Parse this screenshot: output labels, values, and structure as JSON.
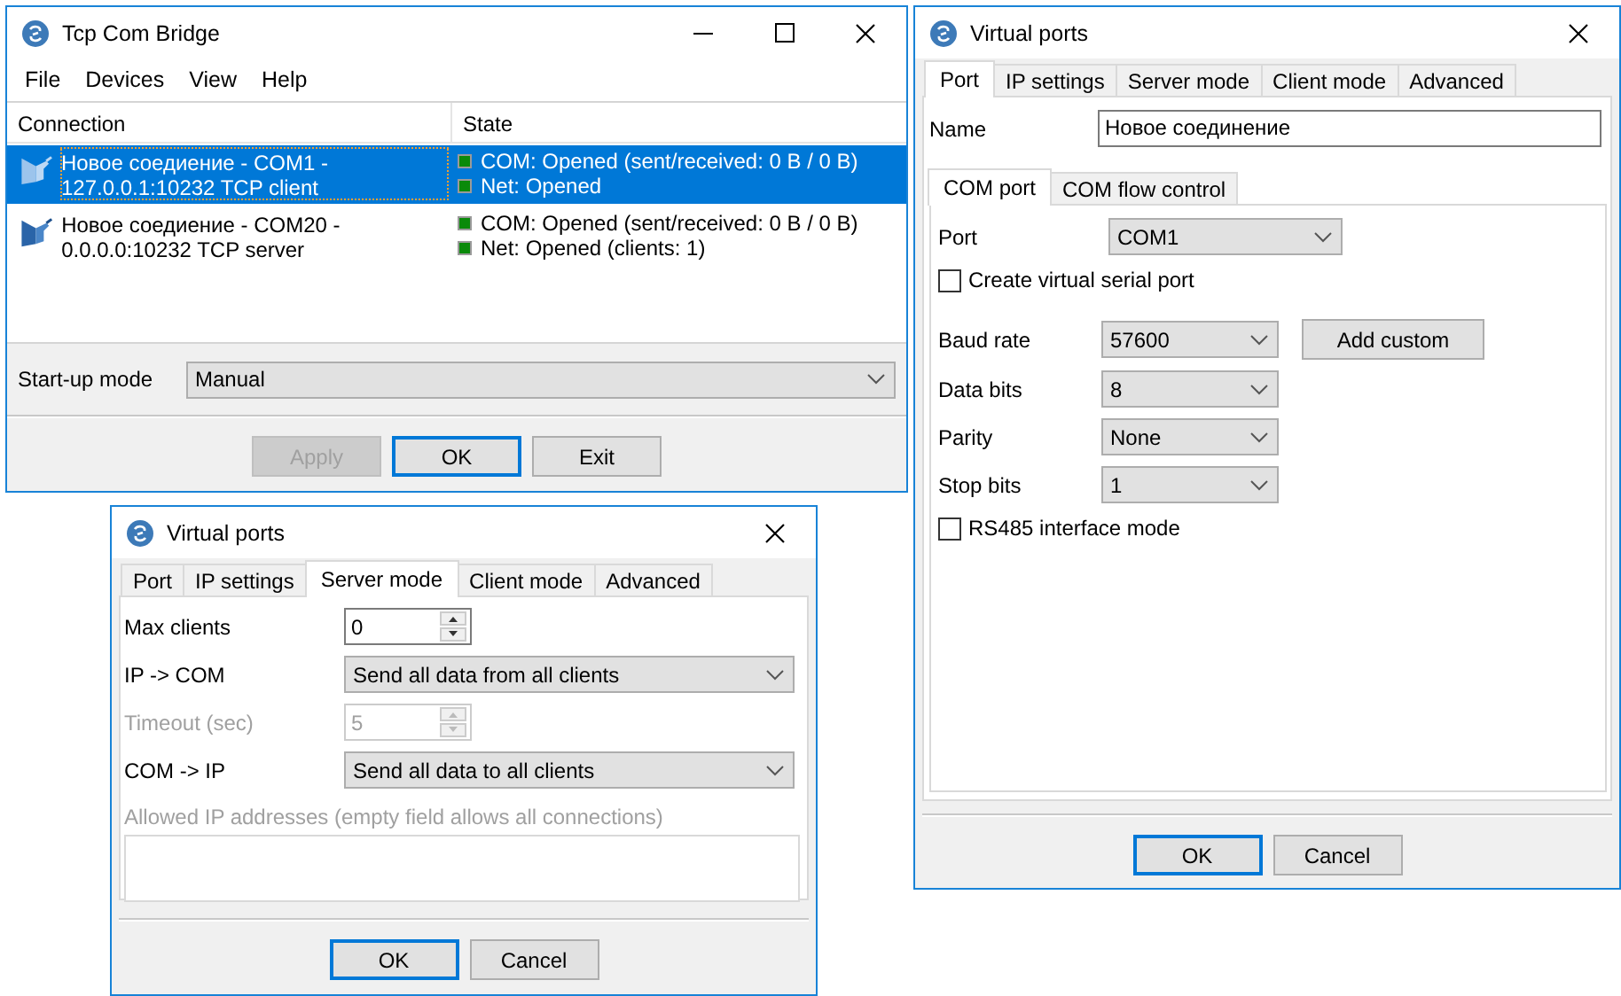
{
  "main_window": {
    "title": "Tcp Com Bridge",
    "menu": [
      "File",
      "Devices",
      "View",
      "Help"
    ],
    "columns": [
      "Connection",
      "State"
    ],
    "rows": [
      {
        "connection": "Новое соедиение - COM1 - 127.0.0.1:10232 TCP client",
        "state": [
          "COM: Opened (sent/received: 0 B / 0 B)",
          "Net: Opened"
        ],
        "selected": true
      },
      {
        "connection": "Новое соедиение - COM20 - 0.0.0.0:10232 TCP server",
        "state": [
          "COM: Opened (sent/received: 0 B / 0 B)",
          "Net: Opened (clients: 1)"
        ],
        "selected": false
      }
    ],
    "startup_mode": {
      "label": "Start-up mode",
      "value": "Manual"
    },
    "buttons": [
      {
        "label": "Apply",
        "disabled": true,
        "default": false
      },
      {
        "label": "OK",
        "disabled": false,
        "default": true
      },
      {
        "label": "Exit",
        "disabled": false,
        "default": false
      }
    ]
  },
  "server_dialog": {
    "title": "Virtual ports",
    "tabs": [
      {
        "label": "Port",
        "selected": false
      },
      {
        "label": "IP settings",
        "selected": false
      },
      {
        "label": "Server mode",
        "selected": true
      },
      {
        "label": "Client mode",
        "selected": false
      },
      {
        "label": "Advanced",
        "selected": false
      }
    ],
    "fields": [
      {
        "kind": "spin",
        "label": "Max clients",
        "value": "0",
        "disabled": false
      },
      {
        "kind": "dropdown",
        "label": "IP -> COM",
        "value": "Send all data from all clients",
        "disabled": false
      },
      {
        "kind": "spin",
        "label": "Timeout (sec)",
        "value": "5",
        "disabled": true
      },
      {
        "kind": "dropdown",
        "label": "COM -> IP",
        "value": "Send all data to all clients",
        "disabled": false
      },
      {
        "kind": "textarea",
        "label": "Allowed IP addresses (empty field allows all connections)",
        "disabled": true
      }
    ],
    "buttons": [
      {
        "label": "OK",
        "disabled": false,
        "default": true
      },
      {
        "label": "Cancel",
        "disabled": false,
        "default": false
      }
    ]
  },
  "port_dialog": {
    "title": "Virtual ports",
    "tabs": [
      {
        "label": "Port",
        "selected": true
      },
      {
        "label": "IP settings",
        "selected": false
      },
      {
        "label": "Server mode",
        "selected": false
      },
      {
        "label": "Client mode",
        "selected": false
      },
      {
        "label": "Advanced",
        "selected": false
      }
    ],
    "name_field": {
      "label": "Name",
      "value": "Новое соединение"
    },
    "subtabs": [
      {
        "label": "COM port",
        "selected": true
      },
      {
        "label": "COM flow control",
        "selected": false
      }
    ],
    "fields": [
      {
        "kind": "dropdown",
        "label": "Port",
        "value": "COM1",
        "disabled": false
      },
      {
        "kind": "checkbox",
        "label": "Create virtual serial port",
        "checked": false,
        "disabled": false
      },
      {
        "kind": "dropdown",
        "label": "Baud rate",
        "value": "57600",
        "button": "Add custom",
        "disabled": false
      },
      {
        "kind": "dropdown",
        "label": "Data bits",
        "value": "8",
        "disabled": false
      },
      {
        "kind": "dropdown",
        "label": "Parity",
        "value": "None",
        "disabled": false
      },
      {
        "kind": "dropdown",
        "label": "Stop bits",
        "value": "1",
        "disabled": false
      },
      {
        "kind": "checkbox",
        "label": "RS485 interface mode",
        "checked": false,
        "disabled": false
      }
    ],
    "buttons": [
      {
        "label": "OK",
        "disabled": false,
        "default": true
      },
      {
        "label": "Cancel",
        "disabled": false,
        "default": false
      }
    ]
  }
}
